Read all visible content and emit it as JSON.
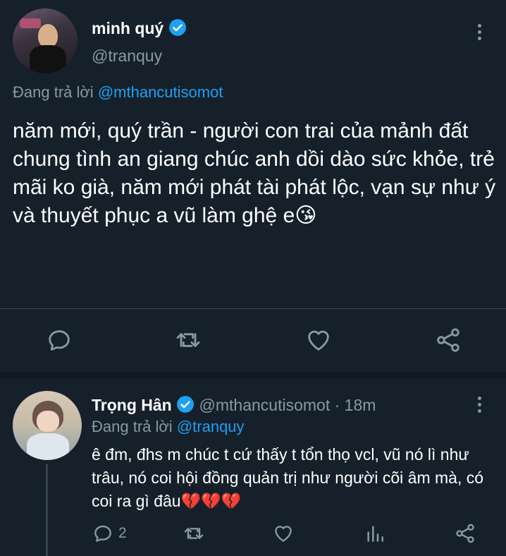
{
  "main_tweet": {
    "author_name": "minh quý",
    "author_handle": "@tranquy",
    "reply_prefix": "Đang trả lời",
    "reply_to": "@mthancutisomot",
    "text": "năm mới, quý trần - người con trai của mảnh đất chung tình an giang chúc anh dồi dào sức khỏe, trẻ mãi ko già, năm mới phát tài phát lộc, vạn sự như ý và thuyết phục a vũ làm ghệ e😘"
  },
  "reply_tweet": {
    "author_name": "Trọng Hân",
    "author_handle": "@mthancutisomot",
    "separator": "·",
    "time": "18m",
    "reply_prefix": "Đang trả lời",
    "reply_to": "@tranquy",
    "text": "ê đm, đhs m chúc t cứ thấy t tổn thọ vcl, vũ nó lì như trâu, nó coi hội đồng quản trị như người cõi âm mà, có coi ra gì đâu💔💔💔",
    "reply_count": "2"
  },
  "icons": [
    "reply-icon",
    "retweet-icon",
    "like-icon",
    "share-icon",
    "analytics-icon",
    "more-icon",
    "verified-icon"
  ],
  "colors": {
    "background": "#15202b",
    "accent": "#1da1f2",
    "muted": "#8899a6",
    "divider": "#38444d"
  }
}
